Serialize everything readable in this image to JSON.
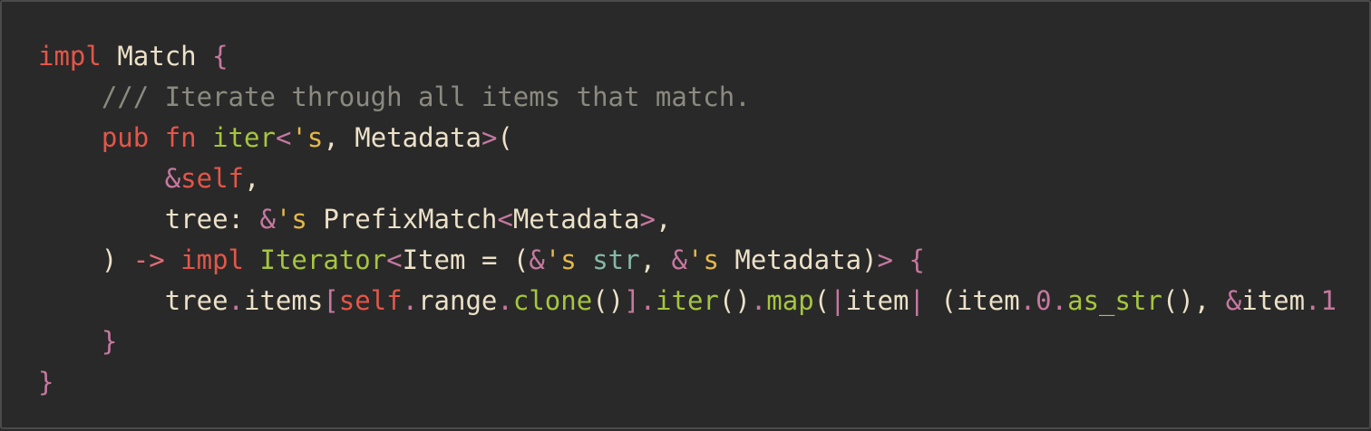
{
  "code": {
    "language": "Rust",
    "lines": [
      [
        {
          "t": "impl",
          "c": "kw"
        },
        {
          "t": " ",
          "c": "plain"
        },
        {
          "t": "Match",
          "c": "type"
        },
        {
          "t": " ",
          "c": "plain"
        },
        {
          "t": "{",
          "c": "punct"
        }
      ],
      [
        {
          "t": "    ",
          "c": "plain"
        },
        {
          "t": "/// Iterate through all items that match.",
          "c": "comment"
        }
      ],
      [
        {
          "t": "    ",
          "c": "plain"
        },
        {
          "t": "pub",
          "c": "kw"
        },
        {
          "t": " ",
          "c": "plain"
        },
        {
          "t": "fn",
          "c": "kw"
        },
        {
          "t": " ",
          "c": "plain"
        },
        {
          "t": "iter",
          "c": "fn"
        },
        {
          "t": "<",
          "c": "punct"
        },
        {
          "t": "'s",
          "c": "lifetime"
        },
        {
          "t": ", ",
          "c": "plain"
        },
        {
          "t": "Metadata",
          "c": "type"
        },
        {
          "t": ">",
          "c": "punct"
        },
        {
          "t": "(",
          "c": "plain"
        }
      ],
      [
        {
          "t": "        ",
          "c": "plain"
        },
        {
          "t": "&",
          "c": "punct"
        },
        {
          "t": "self",
          "c": "self"
        },
        {
          "t": ",",
          "c": "plain"
        }
      ],
      [
        {
          "t": "        ",
          "c": "plain"
        },
        {
          "t": "tree",
          "c": "ident"
        },
        {
          "t": ": ",
          "c": "plain"
        },
        {
          "t": "&",
          "c": "punct"
        },
        {
          "t": "'s",
          "c": "lifetime"
        },
        {
          "t": " ",
          "c": "plain"
        },
        {
          "t": "PrefixMatch",
          "c": "type"
        },
        {
          "t": "<",
          "c": "punct"
        },
        {
          "t": "Metadata",
          "c": "type"
        },
        {
          "t": ">",
          "c": "punct"
        },
        {
          "t": ",",
          "c": "plain"
        }
      ],
      [
        {
          "t": "    ",
          "c": "plain"
        },
        {
          "t": ")",
          "c": "plain"
        },
        {
          "t": " ",
          "c": "plain"
        },
        {
          "t": "->",
          "c": "kw2"
        },
        {
          "t": " ",
          "c": "plain"
        },
        {
          "t": "impl",
          "c": "kw"
        },
        {
          "t": " ",
          "c": "plain"
        },
        {
          "t": "Iterator",
          "c": "trait"
        },
        {
          "t": "<",
          "c": "punct"
        },
        {
          "t": "Item",
          "c": "type"
        },
        {
          "t": " = ",
          "c": "plain"
        },
        {
          "t": "(",
          "c": "plain"
        },
        {
          "t": "&",
          "c": "punct"
        },
        {
          "t": "'s",
          "c": "lifetime"
        },
        {
          "t": " ",
          "c": "plain"
        },
        {
          "t": "str",
          "c": "prim"
        },
        {
          "t": ", ",
          "c": "plain"
        },
        {
          "t": "&",
          "c": "punct"
        },
        {
          "t": "'s",
          "c": "lifetime"
        },
        {
          "t": " ",
          "c": "plain"
        },
        {
          "t": "Metadata",
          "c": "type"
        },
        {
          "t": ")",
          "c": "plain"
        },
        {
          "t": ">",
          "c": "punct"
        },
        {
          "t": " ",
          "c": "plain"
        },
        {
          "t": "{",
          "c": "punct"
        }
      ],
      [
        {
          "t": "        ",
          "c": "plain"
        },
        {
          "t": "tree",
          "c": "ident"
        },
        {
          "t": ".",
          "c": "punct"
        },
        {
          "t": "items",
          "c": "ident"
        },
        {
          "t": "[",
          "c": "punct"
        },
        {
          "t": "self",
          "c": "self"
        },
        {
          "t": ".",
          "c": "punct"
        },
        {
          "t": "range",
          "c": "ident"
        },
        {
          "t": ".",
          "c": "punct"
        },
        {
          "t": "clone",
          "c": "fn"
        },
        {
          "t": "()",
          "c": "plain"
        },
        {
          "t": "]",
          "c": "punct"
        },
        {
          "t": ".",
          "c": "punct"
        },
        {
          "t": "iter",
          "c": "fn"
        },
        {
          "t": "()",
          "c": "plain"
        },
        {
          "t": ".",
          "c": "punct"
        },
        {
          "t": "map",
          "c": "fn"
        },
        {
          "t": "(",
          "c": "plain"
        },
        {
          "t": "|",
          "c": "punct"
        },
        {
          "t": "item",
          "c": "ident"
        },
        {
          "t": "|",
          "c": "punct"
        },
        {
          "t": " ",
          "c": "plain"
        },
        {
          "t": "(",
          "c": "plain"
        },
        {
          "t": "item",
          "c": "ident"
        },
        {
          "t": ".",
          "c": "punct"
        },
        {
          "t": "0",
          "c": "num"
        },
        {
          "t": ".",
          "c": "punct"
        },
        {
          "t": "as_str",
          "c": "fn"
        },
        {
          "t": "()",
          "c": "plain"
        },
        {
          "t": ", ",
          "c": "plain"
        },
        {
          "t": "&",
          "c": "punct"
        },
        {
          "t": "item",
          "c": "ident"
        },
        {
          "t": ".",
          "c": "punct"
        },
        {
          "t": "1",
          "c": "num"
        }
      ],
      [
        {
          "t": "    ",
          "c": "plain"
        },
        {
          "t": "}",
          "c": "punct"
        }
      ],
      [
        {
          "t": "}",
          "c": "punct"
        }
      ]
    ]
  },
  "colors": {
    "background": "#292929",
    "border": "#4a4a4a",
    "keyword": "#e45649",
    "function": "#a6c53f",
    "text": "#ece1c8",
    "punctuation": "#c678a0",
    "comment": "#8a8a80",
    "lifetime": "#e5b84a",
    "primitive": "#86b8a8"
  }
}
